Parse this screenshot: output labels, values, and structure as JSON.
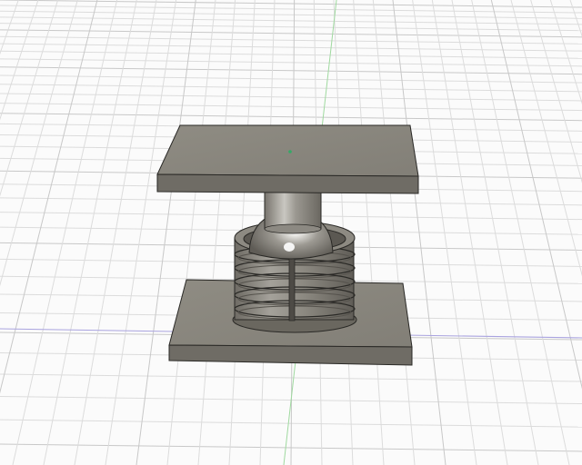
{
  "viewport": {
    "background": "#fbfbfb",
    "grid_minor_color": "#dcdcdc",
    "grid_major_color": "#c8c8c8",
    "axis_x_color": "#a9a3df",
    "axis_y_color": "#9fd99f",
    "origin_marker_color": "#33aa66"
  },
  "model": {
    "body_color": "#87837a",
    "top_face_color": "#8d8a81",
    "side_face_color": "#6f6c65",
    "edge_color": "#2a2926",
    "highlight_color": "#f4f4f2",
    "icons": [
      "top-plate-icon",
      "bottom-plate-icon",
      "threaded-insert-icon",
      "ball-joint-icon"
    ]
  }
}
